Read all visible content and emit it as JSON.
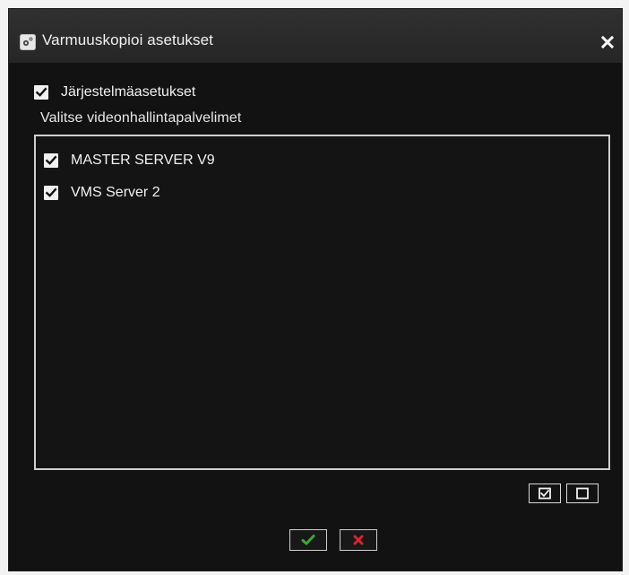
{
  "dialog": {
    "title": "Varmuuskopioi asetukset",
    "system_settings": {
      "label": "Järjestelmäasetukset",
      "checked": true
    },
    "section_label": "Valitse videonhallintapalvelimet",
    "servers": [
      {
        "name": "MASTER SERVER V9",
        "checked": true
      },
      {
        "name": "VMS Server 2",
        "checked": true
      }
    ]
  },
  "icons": {
    "title": "settings-icon",
    "close": "close-icon",
    "select_all": "checkbox-checked-icon",
    "clear_all": "checkbox-empty-icon",
    "confirm": "check-icon",
    "cancel": "x-icon"
  },
  "colors": {
    "dialog_background": "#121212",
    "titlebar_background": "#2b2b2b",
    "text": "#f2f2f2",
    "confirm": "#3da63a",
    "cancel": "#d9252a"
  }
}
